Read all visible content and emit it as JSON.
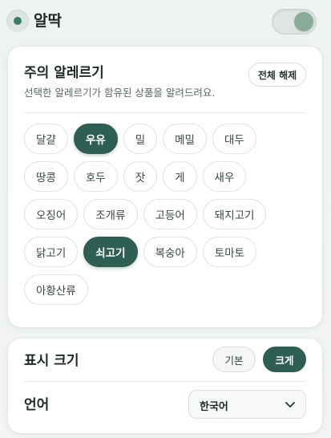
{
  "header": {
    "app_title": "알딱",
    "toggle_on": true
  },
  "allergy": {
    "title": "주의 알레르기",
    "subtitle": "선택한 알레르기가 함유된 상품을 알려드려요.",
    "clear_label": "전체 해제",
    "rows": [
      [
        {
          "label": "달걀",
          "active": false
        },
        {
          "label": "우유",
          "active": true
        },
        {
          "label": "밀",
          "active": false
        },
        {
          "label": "메밀",
          "active": false
        },
        {
          "label": "대두",
          "active": false
        }
      ],
      [
        {
          "label": "땅콩",
          "active": false
        },
        {
          "label": "호두",
          "active": false
        },
        {
          "label": "잣",
          "active": false
        },
        {
          "label": "게",
          "active": false
        },
        {
          "label": "새우",
          "active": false
        }
      ],
      [
        {
          "label": "오징어",
          "active": false
        },
        {
          "label": "조개류",
          "active": false
        },
        {
          "label": "고등어",
          "active": false
        },
        {
          "label": "돼지고기",
          "active": false
        }
      ],
      [
        {
          "label": "닭고기",
          "active": false
        },
        {
          "label": "쇠고기",
          "active": true
        },
        {
          "label": "복숭아",
          "active": false
        },
        {
          "label": "토마토",
          "active": false
        }
      ],
      [
        {
          "label": "아황산류",
          "active": false
        }
      ]
    ]
  },
  "settings": {
    "size_label": "표시 크기",
    "size_basic": "기본",
    "size_large": "크게",
    "language_label": "언어",
    "language_value": "한국어"
  },
  "colors": {
    "accent": "#2f5e52",
    "background": "#eef3f0"
  }
}
